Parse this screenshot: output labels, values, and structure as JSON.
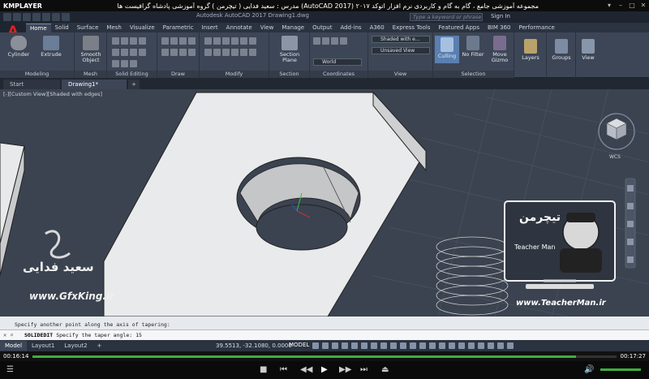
{
  "player": {
    "name": "KMPLAYER",
    "title": "مجموعه آموزشی جامع ، گام به گام و کاربردی نرم افزار  اتوکد ۲۰۱۷ (AutoCAD 2017)  مدرس : سعید فدایی ( تیچرمن ) گروه آموزشی پادشاه گرافیست ها",
    "time_elapsed": "00:16:14",
    "time_total": "00:17:27",
    "progress": 0.93
  },
  "acad": {
    "doc_title": "Autodesk AutoCAD 2017    Drawing1.dwg",
    "search_placeholder": "Type a keyword or phrase",
    "sign_in": "Sign In",
    "logo": "A"
  },
  "ribbon_tabs": [
    "Home",
    "Solid",
    "Surface",
    "Mesh",
    "Visualize",
    "Parametric",
    "Insert",
    "Annotate",
    "View",
    "Manage",
    "Output",
    "Add-ins",
    "A360",
    "Express Tools",
    "Featured Apps",
    "BIM 360",
    "Performance"
  ],
  "ribbon": {
    "cylinder": "Cylinder",
    "extrude": "Extrude",
    "smooth_object": "Smooth Object",
    "section_plane": "Section Plane",
    "culling": "Culling",
    "no_filter": "No Filter",
    "move_gizmo": "Move Gizmo",
    "layers": "Layers",
    "groups": "Groups",
    "view": "View",
    "visual_style": "Shaded with e...",
    "saved_view": "Unsaved View",
    "coord": "World",
    "groups_labels": [
      "Modeling",
      "Mesh",
      "Solid Editing",
      "Draw",
      "Modify",
      "Section",
      "Coordinates",
      "View",
      "Selection"
    ]
  },
  "file_tabs": [
    "Start",
    "Drawing1*"
  ],
  "viewport": {
    "label": "[-][Custom View][Shaded with edges]",
    "viewcube_label": "WCS",
    "watermark_name": "سعید فدایی",
    "watermark_site": "www.GfxKing.ir",
    "teacher_logo": "تیچرمن",
    "teacher_name": "Teacher Man",
    "teacher_site": "www.TeacherMan.ir"
  },
  "command": {
    "history": "Specify another point along the axis of tapering:",
    "name": "SOLIDEDIT",
    "prompt": "Specify the taper angle: 15"
  },
  "status": {
    "layout_tabs": [
      "Model",
      "Layout1",
      "Layout2"
    ],
    "coordinates": "39.5513, -32.1080, 0.0000",
    "mode": "MODEL"
  }
}
